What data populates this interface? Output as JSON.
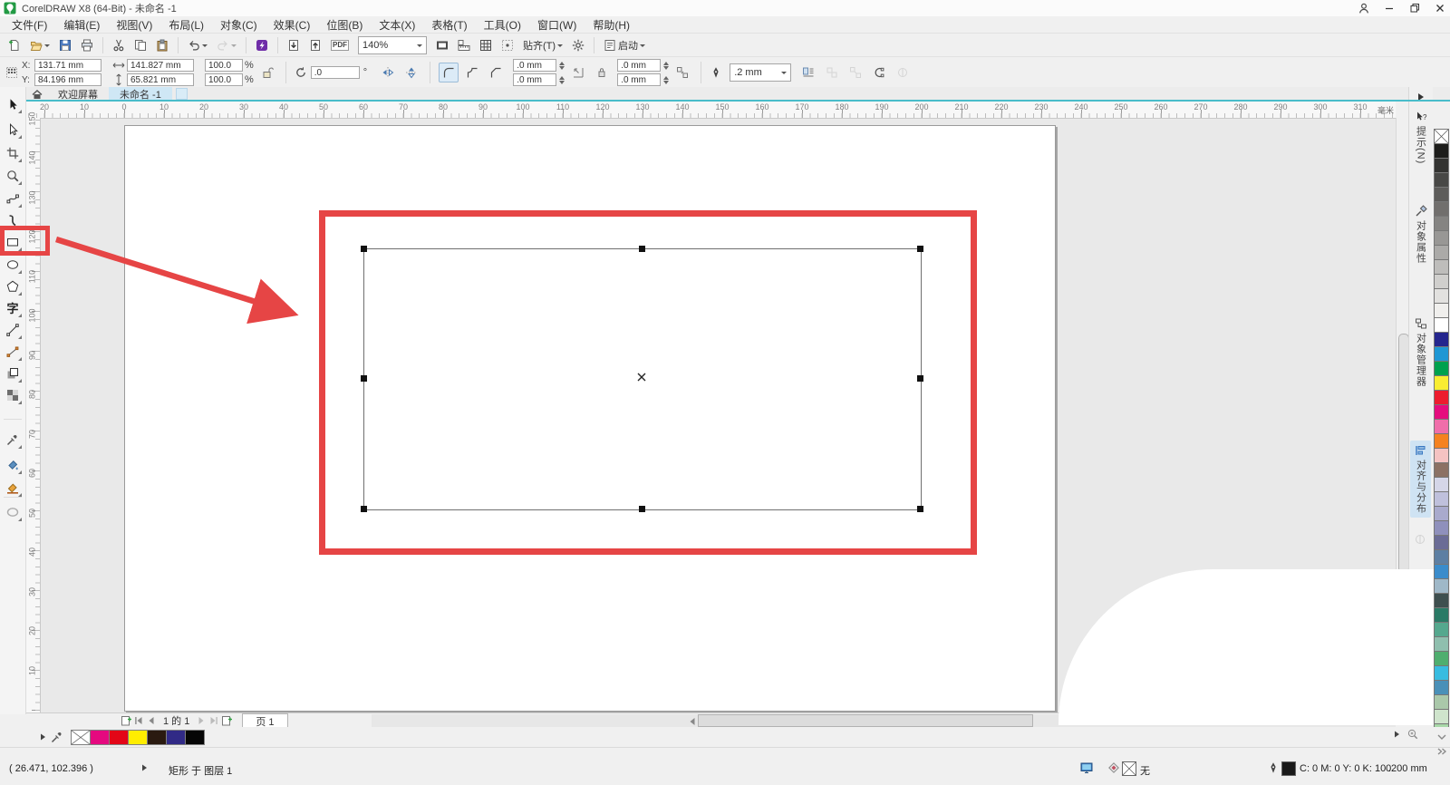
{
  "window": {
    "title": "CorelDRAW X8 (64-Bit) - 未命名 -1",
    "controls": [
      "user-account",
      "minimize",
      "restore",
      "close"
    ]
  },
  "menubar": {
    "items": [
      "文件(F)",
      "编辑(E)",
      "视图(V)",
      "布局(L)",
      "对象(C)",
      "效果(C)",
      "位图(B)",
      "文本(X)",
      "表格(T)",
      "工具(O)",
      "窗口(W)",
      "帮助(H)"
    ]
  },
  "toolbar": {
    "zoom_value": "140%",
    "snap_label": "贴齐(T)",
    "launch_label": "启动",
    "pdf_label": "PDF",
    "buttons": [
      {
        "name": "new-document"
      },
      {
        "name": "open-document",
        "dropdown": true
      },
      {
        "name": "save-document"
      },
      {
        "name": "print"
      },
      {
        "sep": true
      },
      {
        "name": "cut"
      },
      {
        "name": "copy"
      },
      {
        "name": "paste"
      },
      {
        "sep": true
      },
      {
        "name": "undo",
        "dropdown": true
      },
      {
        "name": "redo",
        "dropdown": true,
        "disabled": true
      },
      {
        "sep": true
      },
      {
        "name": "search-content"
      },
      {
        "sep": true
      },
      {
        "name": "import"
      },
      {
        "name": "export"
      },
      {
        "name": "publish-pdf"
      },
      {
        "zoom": true
      },
      {
        "name": "full-screen-preview"
      },
      {
        "name": "show-rulers"
      },
      {
        "name": "show-grid"
      },
      {
        "name": "snap-options"
      },
      {
        "snap": true
      },
      {
        "name": "options-gear"
      },
      {
        "sep": true
      },
      {
        "launch": true
      }
    ]
  },
  "propbar": {
    "x_label": "X:",
    "y_label": "Y:",
    "x_value": "131.71 mm",
    "y_value": "84.196 mm",
    "width_value": "141.827 mm",
    "height_value": "65.821 mm",
    "scale_h": "100.0",
    "scale_v": "100.0",
    "percent": "%",
    "angle_value": ".0",
    "degree": "°",
    "corner_values": [
      ".0 mm",
      ".0 mm",
      ".0 mm",
      ".0 mm"
    ],
    "outline_width": ".2 mm"
  },
  "docbar": {
    "tabs": [
      {
        "label": "欢迎屏幕",
        "active": false
      },
      {
        "label": "未命名 -1",
        "active": true
      }
    ]
  },
  "rulers": {
    "unit_label": "毫米",
    "h_labels": [
      "20",
      "10",
      "0",
      "10",
      "20",
      "30",
      "40",
      "50",
      "60",
      "70",
      "80",
      "90",
      "100",
      "110",
      "120",
      "130",
      "140",
      "150",
      "160",
      "170",
      "180",
      "190",
      "200",
      "210",
      "220",
      "230",
      "240",
      "250",
      "260",
      "270",
      "280",
      "290",
      "300",
      "310"
    ],
    "v_labels": [
      "150",
      "140",
      "130",
      "120",
      "110",
      "100",
      "90",
      "80",
      "70",
      "60",
      "50",
      "40",
      "30",
      "20",
      "10"
    ]
  },
  "toolbox": {
    "highlighted": "rectangle-tool",
    "text_tool_glyph": "字",
    "tools": [
      "pick-tool",
      "shape-tool",
      "crop-tool",
      "zoom-tool",
      "freehand-tool",
      "artistic-media-tool",
      "rectangle-tool",
      "ellipse-tool",
      "polygon-tool",
      "text-tool",
      "parallel-dimension-tool",
      "connector-tool",
      "drop-shadow-tool",
      "transparency-tool",
      "color-eyedropper-tool",
      "interactive-fill-tool",
      "smart-fill-tool",
      "outline-pen-tool"
    ]
  },
  "dockers": {
    "tabs": [
      {
        "label": "提示(N)",
        "icon": "hint-icon",
        "active": false
      },
      {
        "label": "对象属性",
        "icon": "object-properties-icon",
        "active": false
      },
      {
        "label": "对象管理器",
        "icon": "object-manager-icon",
        "active": false
      },
      {
        "label": "对齐与分布",
        "icon": "align-distribute-icon",
        "active": true
      }
    ]
  },
  "palette": {
    "colors": [
      "none",
      "#1d1d1b",
      "#333331",
      "#484846",
      "#5d5c5a",
      "#716f6d",
      "#858482",
      "#989795",
      "#abaaa8",
      "#bebdbb",
      "#d0cfcd",
      "#e2e1df",
      "#f0efed",
      "#ffffff",
      "#25268e",
      "#1e97d4",
      "#00a14e",
      "#f9ed32",
      "#ed1c2e",
      "#e50c7e",
      "#f06eaa",
      "#f58220",
      "#f5c3c2",
      "#8c7164",
      "#d5d6e8",
      "#bfc0dc",
      "#a9aacd",
      "#8f90bc",
      "#6b6c96",
      "#5d7fa3",
      "#3b8ccb",
      "#9fb8c8",
      "#3e4f4f",
      "#2a7a66",
      "#55a88e",
      "#8fbfae",
      "#4fae6f",
      "#38bce0",
      "#4a90b8",
      "#aac8aa",
      "#cfe4cc",
      "#a8d8a8"
    ]
  },
  "pagebar": {
    "page_info": "1 的 1",
    "page_tab": "页 1"
  },
  "docpalette": {
    "colors": [
      "none",
      "#e5097f",
      "#e30617",
      "#ffed00",
      "#2a1a10",
      "#312a86",
      "#060606"
    ]
  },
  "statusbar": {
    "cursor_pos": "( 26.471, 102.396 )",
    "object_info": "矩形 于 图层 1",
    "fill_value": "无",
    "outline_cmyk": "C: 0 M: 0 Y: 0 K: 100",
    "outline_width": ".200 mm"
  },
  "accents": {
    "annotation_red": "#e64545",
    "tab_teal": "#49bcca",
    "docker_active_bg": "#cfe3f3"
  }
}
